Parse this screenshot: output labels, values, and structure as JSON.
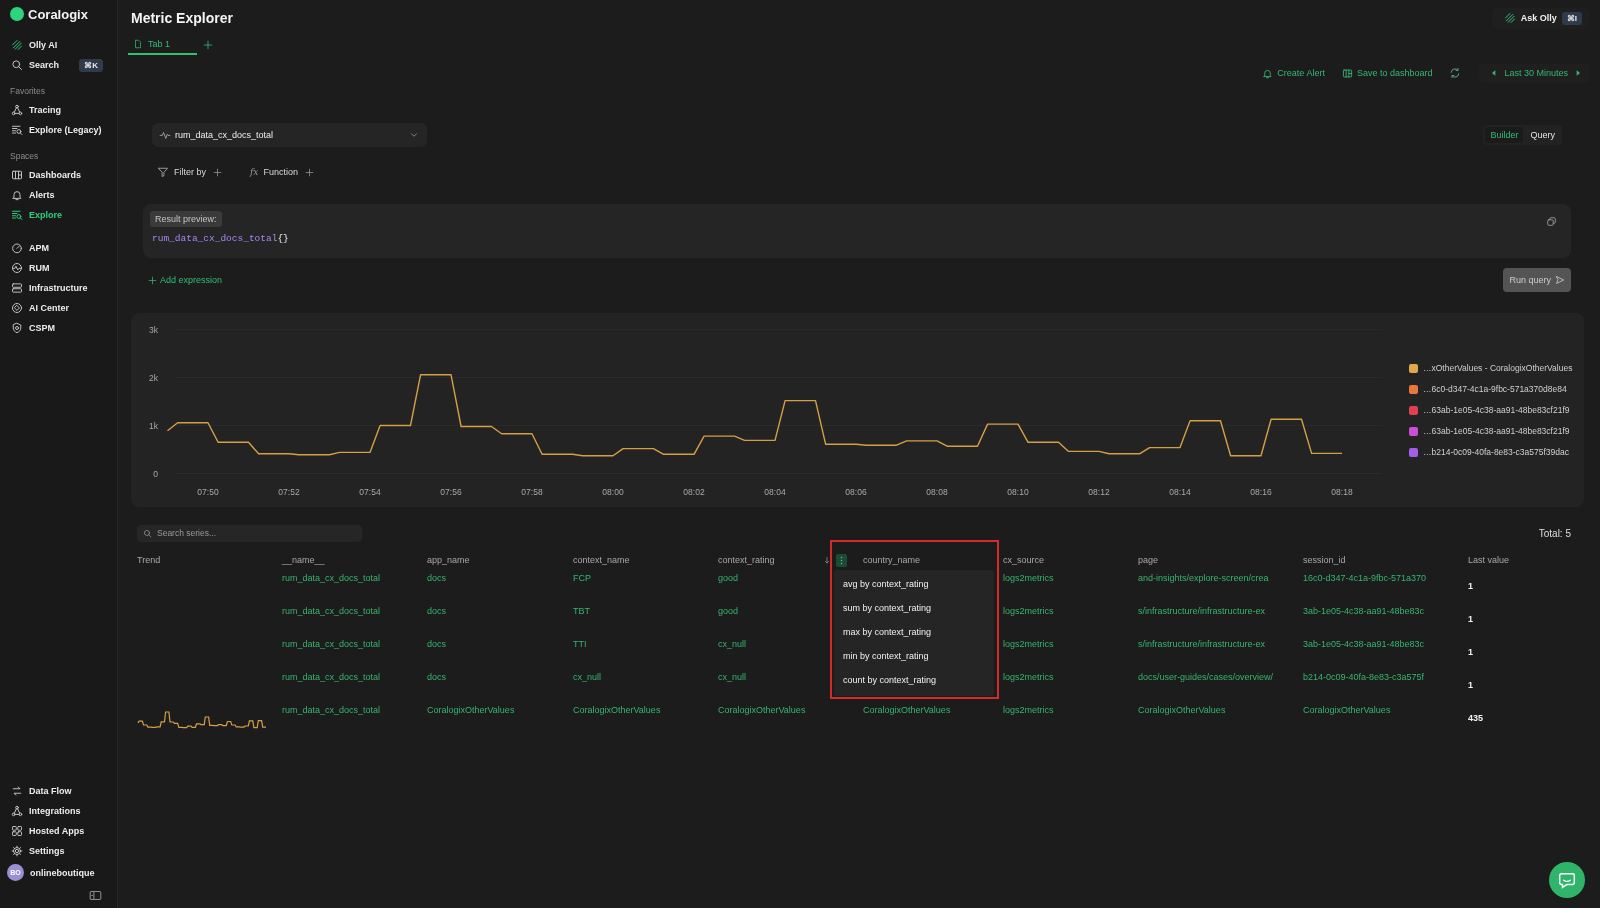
{
  "sidebar": {
    "brand": "Coralogix",
    "sections": [
      {
        "items": [
          {
            "label": "Olly AI",
            "selected": false
          },
          {
            "label": "Search",
            "shortcut": "⌘K",
            "selected": false
          }
        ]
      },
      {
        "heading": "Favorites",
        "items": [
          {
            "label": "Tracing",
            "selected": false
          },
          {
            "label": "Explore (Legacy)",
            "selected": false
          }
        ]
      },
      {
        "heading": "Spaces",
        "items": [
          {
            "label": "Dashboards",
            "selected": false
          },
          {
            "label": "Alerts",
            "selected": false
          },
          {
            "label": "Explore",
            "selected": true
          }
        ]
      },
      {
        "items": [
          {
            "label": "APM",
            "selected": false
          },
          {
            "label": "RUM",
            "selected": false
          },
          {
            "label": "Infrastructure",
            "selected": false
          },
          {
            "label": "AI Center",
            "selected": false
          },
          {
            "label": "CSPM",
            "selected": false
          }
        ]
      }
    ],
    "bottom_items": [
      {
        "label": "Data Flow",
        "selected": false
      },
      {
        "label": "Integrations",
        "selected": false
      },
      {
        "label": "Hosted Apps",
        "selected": false
      },
      {
        "label": "Settings",
        "selected": false
      }
    ],
    "account": {
      "initials": "BO",
      "name": "onlineboutique"
    }
  },
  "header": {
    "title": "Metric Explorer",
    "tabs": [
      {
        "label": "Tab 1",
        "selected": true
      }
    ],
    "ask_olly": {
      "label": "Ask Olly",
      "shortcut": "⌘I"
    }
  },
  "toolbar": {
    "actions": [
      {
        "label": "Create Alert"
      },
      {
        "label": "Save to dashboard"
      }
    ],
    "time_range": "Last 30 Minutes"
  },
  "query": {
    "metric": "rum_data_cx_docs_total",
    "mode_toggle": [
      {
        "label": "Builder",
        "selected": true
      },
      {
        "label": "Query",
        "selected": false
      }
    ],
    "filters": [
      {
        "kind": "filter",
        "label": "Filter by"
      },
      {
        "kind": "function",
        "symbol": "fx",
        "label": "Function"
      }
    ],
    "result_preview": {
      "label": "Result preview:",
      "metric": "rum_data_cx_docs_total",
      "selector": "{}"
    },
    "add_expression": "Add expression",
    "run_button": {
      "label": "Run query",
      "disabled": true
    }
  },
  "chart": {
    "chart_data": {
      "type": "line",
      "categories": [
        null,
        null,
        null,
        null,
        "07:50",
        null,
        null,
        null,
        null,
        null,
        null,
        null,
        "07:52",
        null,
        null,
        null,
        null,
        null,
        null,
        null,
        "07:54",
        null,
        null,
        null,
        null,
        null,
        null,
        null,
        "07:56",
        null,
        null,
        null,
        null,
        null,
        null,
        null,
        "07:58",
        null,
        null,
        null,
        null,
        null,
        null,
        null,
        "08:00",
        null,
        null,
        null,
        null,
        null,
        null,
        null,
        "08:02",
        null,
        null,
        null,
        null,
        null,
        null,
        null,
        "08:04",
        null,
        null,
        null,
        null,
        null,
        null,
        null,
        "08:06",
        null,
        null,
        null,
        null,
        null,
        null,
        null,
        "08:08",
        null,
        null,
        null,
        null,
        null,
        null,
        null,
        "08:10",
        null,
        null,
        null,
        null,
        null,
        null,
        null,
        "08:12",
        null,
        null,
        null,
        null,
        null,
        null,
        null,
        "08:14",
        null,
        null,
        null,
        null,
        null,
        null,
        null,
        "08:16",
        null,
        null,
        null,
        null,
        null,
        null,
        null,
        "08:18"
      ],
      "series": [
        {
          "color": "#d4a045",
          "values": [
            890,
            1060,
            1060,
            1060,
            1060,
            650,
            650,
            650,
            650,
            410,
            410,
            410,
            410,
            390,
            390,
            390,
            390,
            440,
            440,
            440,
            440,
            1000,
            1000,
            1000,
            1000,
            2060,
            2060,
            2060,
            2060,
            980,
            980,
            980,
            980,
            830,
            830,
            830,
            830,
            400,
            400,
            400,
            400,
            370,
            370,
            370,
            370,
            520,
            520,
            520,
            520,
            400,
            400,
            400,
            400,
            780,
            780,
            780,
            780,
            690,
            690,
            690,
            690,
            1520,
            1520,
            1520,
            1520,
            610,
            610,
            610,
            610,
            590,
            590,
            590,
            590,
            680,
            680,
            680,
            680,
            570,
            570,
            570,
            570,
            1030,
            1030,
            1030,
            1030,
            650,
            650,
            650,
            650,
            460,
            460,
            460,
            460,
            410,
            410,
            410,
            410,
            540,
            540,
            540,
            540,
            1100,
            1100,
            1100,
            1100,
            370,
            370,
            370,
            370,
            1130,
            1130,
            1130,
            1130,
            420,
            420,
            420,
            420
          ]
        }
      ],
      "ylim": [
        0,
        3000
      ],
      "yticks": [
        {
          "value": 0,
          "label": "0"
        },
        {
          "value": 1000,
          "label": "1k"
        },
        {
          "value": 2000,
          "label": "2k"
        },
        {
          "value": 3000,
          "label": "3k"
        }
      ]
    },
    "legend": [
      {
        "label": "…xOtherValues - CoralogixOtherValues",
        "color": "#e0a84a"
      },
      {
        "label": "…6c0-d347-4c1a-9fbc-571a370d8e84",
        "color": "#e8783a"
      },
      {
        "label": "…63ab-1e05-4c38-aa91-48be83cf21f9",
        "color": "#e0404f"
      },
      {
        "label": "…63ab-1e05-4c38-aa91-48be83cf21f9",
        "color": "#c94fd6"
      },
      {
        "label": "…b214-0c09-40fa-8e83-c3a575f39dac",
        "color": "#a35de8"
      }
    ]
  },
  "table": {
    "search": {
      "placeholder": "Search series..."
    },
    "total": "Total: 5",
    "columns": [
      {
        "label": "Trend"
      },
      {
        "label": "__name__"
      },
      {
        "label": "app_name"
      },
      {
        "label": "context_name"
      },
      {
        "label": "context_rating",
        "sort_descending": true,
        "menu_open": true
      },
      {
        "label": "country_name"
      },
      {
        "label": "cx_source"
      },
      {
        "label": "page"
      },
      {
        "label": "session_id"
      },
      {
        "label": "Last value"
      }
    ],
    "rows": [
      {
        "trend": false,
        "cells": [
          "",
          "rum_data_cx_docs_total",
          "docs",
          "FCP",
          "good",
          "",
          "logs2metrics",
          "and-insights/explore-screen/crea",
          "16c0-d347-4c1a-9fbc-571a370",
          "1"
        ]
      },
      {
        "trend": false,
        "cells": [
          "",
          "rum_data_cx_docs_total",
          "docs",
          "TBT",
          "good",
          "",
          "logs2metrics",
          "s/infrastructure/infrastructure-ex",
          "3ab-1e05-4c38-aa91-48be83c",
          "1"
        ]
      },
      {
        "trend": false,
        "cells": [
          "",
          "rum_data_cx_docs_total",
          "docs",
          "TTI",
          "cx_null",
          "",
          "logs2metrics",
          "s/infrastructure/infrastructure-ex",
          "3ab-1e05-4c38-aa91-48be83c",
          "1"
        ]
      },
      {
        "trend": false,
        "cells": [
          "",
          "rum_data_cx_docs_total",
          "docs",
          "cx_null",
          "cx_null",
          "",
          "logs2metrics",
          "docs/user-guides/cases/overview/",
          "b214-0c09-40fa-8e83-c3a575f",
          "1"
        ]
      },
      {
        "trend": true,
        "cells": [
          "",
          "rum_data_cx_docs_total",
          "CoralogixOtherValues",
          "CoralogixOtherValues",
          "CoralogixOtherValues",
          "CoralogixOtherValues",
          "logs2metrics",
          "CoralogixOtherValues",
          "CoralogixOtherValues",
          "435"
        ]
      }
    ],
    "column_menu": {
      "items": [
        "avg by context_rating",
        "sum by context_rating",
        "max by context_rating",
        "min by context_rating",
        "count by context_rating"
      ],
      "highlighted": true
    }
  }
}
